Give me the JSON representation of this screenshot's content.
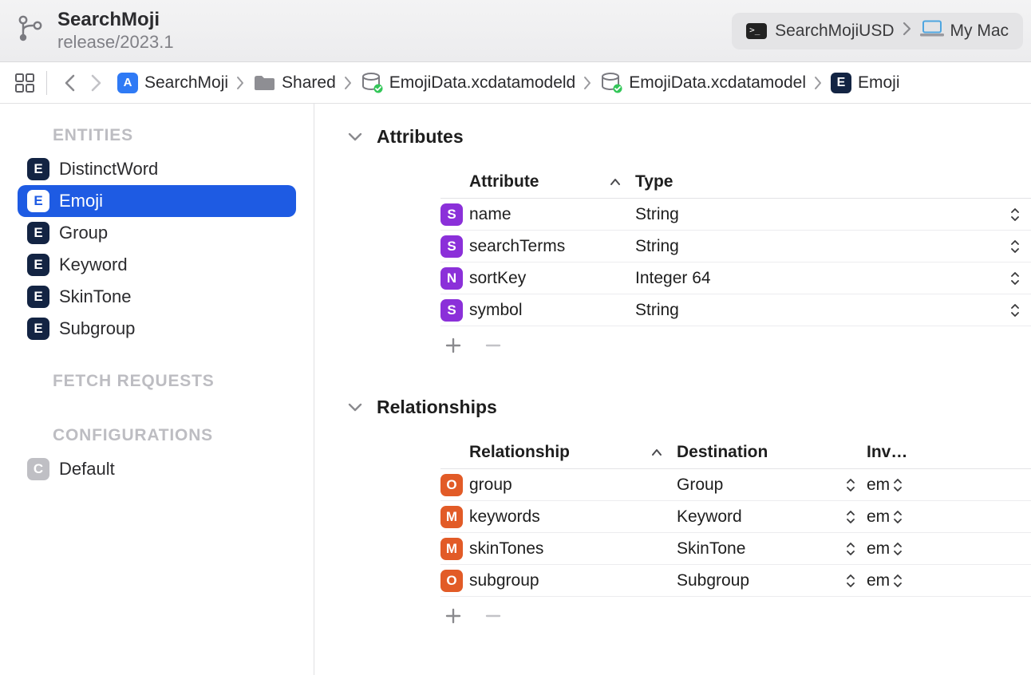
{
  "toolbar": {
    "project_name": "SearchMoji",
    "branch": "release/2023.1",
    "scheme": "SearchMojiUSD",
    "destination": "My Mac"
  },
  "breadcrumbs": [
    {
      "kind": "app",
      "label": "SearchMoji"
    },
    {
      "kind": "folder",
      "label": "Shared"
    },
    {
      "kind": "model",
      "label": "EmojiData.xcdatamodeld"
    },
    {
      "kind": "modelv",
      "label": "EmojiData.xcdatamodel"
    },
    {
      "kind": "entity",
      "label": "Emoji"
    }
  ],
  "sidebar": {
    "sections": {
      "entities_label": "ENTITIES",
      "fetch_label": "FETCH REQUESTS",
      "config_label": "CONFIGURATIONS"
    },
    "entities": [
      {
        "name": "DistinctWord",
        "selected": false
      },
      {
        "name": "Emoji",
        "selected": true
      },
      {
        "name": "Group",
        "selected": false
      },
      {
        "name": "Keyword",
        "selected": false
      },
      {
        "name": "SkinTone",
        "selected": false
      },
      {
        "name": "Subgroup",
        "selected": false
      }
    ],
    "configurations": [
      {
        "name": "Default"
      }
    ]
  },
  "editor": {
    "attributes": {
      "title": "Attributes",
      "columns": {
        "name": "Attribute",
        "type": "Type"
      },
      "rows": [
        {
          "badge": "S",
          "name": "name",
          "type": "String"
        },
        {
          "badge": "S",
          "name": "searchTerms",
          "type": "String"
        },
        {
          "badge": "N",
          "name": "sortKey",
          "type": "Integer 64"
        },
        {
          "badge": "S",
          "name": "symbol",
          "type": "String"
        }
      ]
    },
    "relationships": {
      "title": "Relationships",
      "columns": {
        "name": "Relationship",
        "dest": "Destination",
        "inv": "Inv…"
      },
      "rows": [
        {
          "badge": "O",
          "name": "group",
          "dest": "Group",
          "inv": "em"
        },
        {
          "badge": "M",
          "name": "keywords",
          "dest": "Keyword",
          "inv": "em"
        },
        {
          "badge": "M",
          "name": "skinTones",
          "dest": "SkinTone",
          "inv": "em"
        },
        {
          "badge": "O",
          "name": "subgroup",
          "dest": "Subgroup",
          "inv": "em"
        }
      ]
    }
  }
}
